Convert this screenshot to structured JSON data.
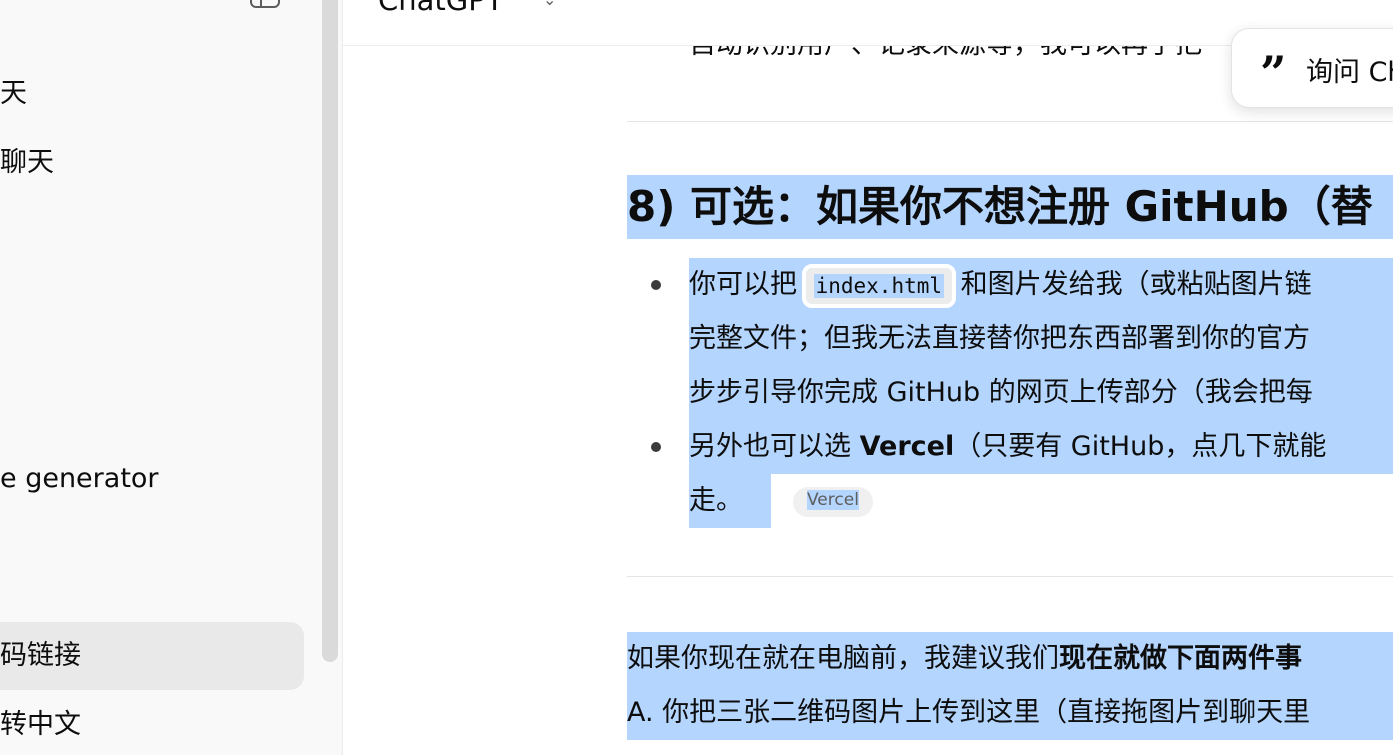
{
  "header": {
    "title": "ChatGPT"
  },
  "sidebar": {
    "items": [
      {
        "label": "天"
      },
      {
        "label": "聊天"
      },
      {
        "label": "e generator"
      },
      {
        "label": "码链接"
      },
      {
        "label": "转中文"
      }
    ]
  },
  "popover": {
    "ask_label": "询问 Ch"
  },
  "message": {
    "cut_line": "自动识别用户、记录来源等，我可以再手把",
    "section_heading": "8) 可选：如果你不想注册 GitHub（替",
    "bullet1": {
      "line1_pre": "你可以把 ",
      "code": "index.html",
      "line1_post": " 和图片发给我（或粘贴图片链",
      "line2": "完整文件；但我无法直接替你把东西部署到你的官方",
      "line3": "步步引导你完成 GitHub 的网页上传部分（我会把每"
    },
    "bullet2": {
      "line1_pre": "另外也可以选 ",
      "line1_bold": "Vercel",
      "line1_post": "（只要有 GitHub，点几下就能",
      "line2": "走。",
      "pill": "Vercel"
    },
    "para1_pre": "如果你现在就在电脑前，我建议我们",
    "para1_bold": "现在就做下面两件事",
    "para2": "A. 你把三张二维码图片上传到这里（直接拖图片到聊天里"
  },
  "colors": {
    "selection": "#b4d5fe",
    "sidebar_bg": "#f9f9f9",
    "active_item": "#e9e9e9"
  }
}
